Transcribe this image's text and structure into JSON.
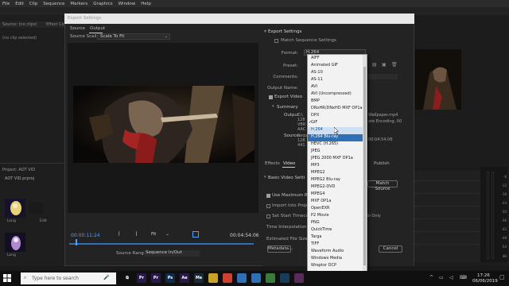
{
  "menu": [
    "File",
    "Edit",
    "Clip",
    "Sequence",
    "Markers",
    "Graphics",
    "Window",
    "Help"
  ],
  "source_panel": {
    "tabs": [
      "Source: (no clips)",
      "Effect Controls"
    ],
    "no_clip": "(no clip selected)"
  },
  "dialog": {
    "title": "Export Settings",
    "tabs": [
      "Source",
      "Output"
    ],
    "source_scaling_label": "Source Scaling:",
    "source_scaling_value": "Scale To Fit",
    "timecode_in": "00:00:11:24",
    "timecode_out": "00:04:54:06",
    "fit_value": "Fit",
    "source_range_label": "Source Range:",
    "source_range_value": "Sequence In/Out"
  },
  "export_settings": {
    "header": "Export Settings",
    "match_sequence_label": "Match Sequence Settings",
    "format_label": "Format:",
    "format_value": "H.264",
    "preset_label": "Preset:",
    "comments_label": "Comments:",
    "output_name_label": "Output Name:",
    "export_video_label": "Export Video",
    "summary_label": "Summary",
    "output_label": "Output:",
    "output_lines": [
      "C:\\",
      "128",
      "VBR",
      "AAC"
    ],
    "source_label": "Source:",
    "source_lines": [
      "Sequ",
      "128",
      "441"
    ],
    "right_info_1": "Wallpaper.mp4",
    "right_info_2": "are Encoding, 00",
    "right_info_3": "00:04:54:06"
  },
  "lower_tabs": {
    "effects": "Effects",
    "video": "Video",
    "publish": "Publish"
  },
  "basic_video": {
    "header": "Basic Video Setti",
    "match_source": "Match Source",
    "use_max": "Use Maximum Ren",
    "import_project": "Import Into Project",
    "set_start_tc": "Set Start Timecode",
    "channel_only": "nnel Only",
    "time_interp": "Time Interpolation:",
    "est_size": "Estimated File Size:",
    "metadata_btn": "Metadata...",
    "cancel_btn": "Cancel"
  },
  "dropdown": {
    "items": [
      "AIFF",
      "Animated GIF",
      "AS-10",
      "AS-11",
      "AVI",
      "AVI (Uncompressed)",
      "BMP",
      "DNxHR/DNxHD MXF OP1a",
      "DPX",
      "GIF",
      "H.264",
      "H.264 Blu-ray",
      "HEVC (H.265)",
      "JPEG",
      "JPEG 2000 MXF OP1a",
      "MP3",
      "MPEG2",
      "MPEG2 Blu-ray",
      "MPEG2-DVD",
      "MPEG4",
      "MXF OP1a",
      "OpenEXR",
      "P2 Movie",
      "PNG",
      "QuickTime",
      "Targa",
      "TIFF",
      "Waveform Audio",
      "Windows Media",
      "Wraptor DCP"
    ],
    "checked_item": "H.264",
    "hover_item": "H.264 Blu-ray"
  },
  "project": {
    "label": "Project: AOT VID",
    "path": "AOT VID.prproj",
    "thumb_labels": [
      "Long",
      "Edit",
      "Long"
    ]
  },
  "vu_ticks": [
    "-6",
    "-12",
    "-18",
    "-24",
    "-30",
    "-36",
    "-42",
    "-48",
    "-54",
    "dB"
  ],
  "taskbar": {
    "search_placeholder": "Type here to search",
    "time": "17:26",
    "date": "06/06/2019",
    "apps": [
      {
        "name": "task-view-icon",
        "label": "⧉",
        "color": "#101010"
      },
      {
        "name": "premiere-icon",
        "label": "Pr",
        "color": "#2a1a4a"
      },
      {
        "name": "premiere-icon-2",
        "label": "Pr",
        "color": "#2a1a4a"
      },
      {
        "name": "photoshop-icon",
        "label": "Ps",
        "color": "#0f2a4a"
      },
      {
        "name": "after-effects-icon",
        "label": "Ae",
        "color": "#2a1a4a"
      },
      {
        "name": "media-encoder-icon",
        "label": "Me",
        "color": "#1a2a3a"
      },
      {
        "name": "file-explorer-icon",
        "label": "",
        "color": "#c9a227"
      },
      {
        "name": "chrome-icon",
        "label": "",
        "color": "#d04030"
      },
      {
        "name": "mail-icon",
        "label": "",
        "color": "#2f6fb5"
      },
      {
        "name": "store-icon",
        "label": "",
        "color": "#2f6fb5"
      },
      {
        "name": "game-icon",
        "label": "",
        "color": "#3a7a3a"
      },
      {
        "name": "steam-icon",
        "label": "",
        "color": "#1a3a5a"
      },
      {
        "name": "app-icon",
        "label": "",
        "color": "#5a2a5a"
      }
    ]
  }
}
